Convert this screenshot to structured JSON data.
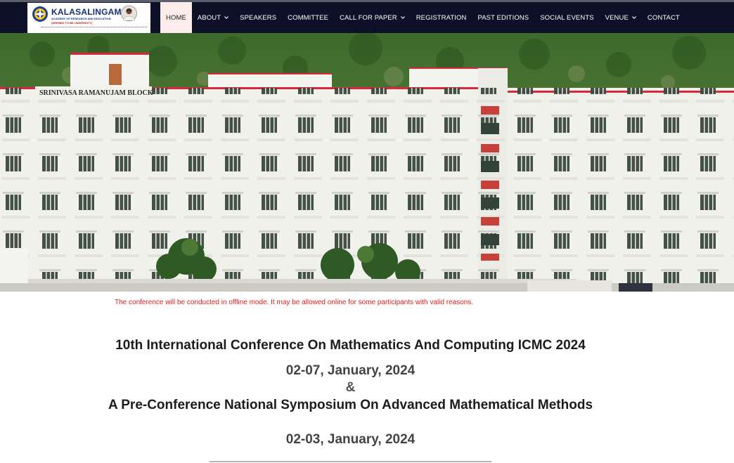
{
  "logo": {
    "title": "KALASALINGAM",
    "subtitle": "ACADEMY OF RESEARCH AND EDUCATION",
    "tagline": "(DEEMED TO BE UNIVERSITY)"
  },
  "nav": {
    "items": [
      {
        "label": "HOME",
        "active": true,
        "dropdown": false
      },
      {
        "label": "ABOUT",
        "active": false,
        "dropdown": true
      },
      {
        "label": "SPEAKERS",
        "active": false,
        "dropdown": false
      },
      {
        "label": "COMMITTEE",
        "active": false,
        "dropdown": false
      },
      {
        "label": "CALL FOR PAPER",
        "active": false,
        "dropdown": true
      },
      {
        "label": "REGISTRATION",
        "active": false,
        "dropdown": false
      },
      {
        "label": "PAST EDITIONS",
        "active": false,
        "dropdown": false
      },
      {
        "label": "SOCIAL EVENTS",
        "active": false,
        "dropdown": false
      },
      {
        "label": "VENUE",
        "active": false,
        "dropdown": true
      },
      {
        "label": "CONTACT",
        "active": false,
        "dropdown": false
      }
    ]
  },
  "hero": {
    "building_sign": "SRINIVASA RAMANUJAM BLOCK"
  },
  "content": {
    "notice": "The conference will be conducted in offline mode. It may be allowed online for some participants with valid reasons.",
    "conference_title": "10th International Conference On Mathematics And Computing ICMC 2024",
    "conference_dates": "02-07, January, 2024",
    "ampersand": "&",
    "symposium_title": "A Pre-Conference National Symposium On Advanced Mathematical Methods",
    "symposium_dates": "02-03, January, 2024"
  },
  "colors": {
    "nav_bg": "#0d1027",
    "nav_active_bg": "#fdeceb",
    "notice_red": "#e21b1b",
    "building_trim": "#d9283a"
  }
}
